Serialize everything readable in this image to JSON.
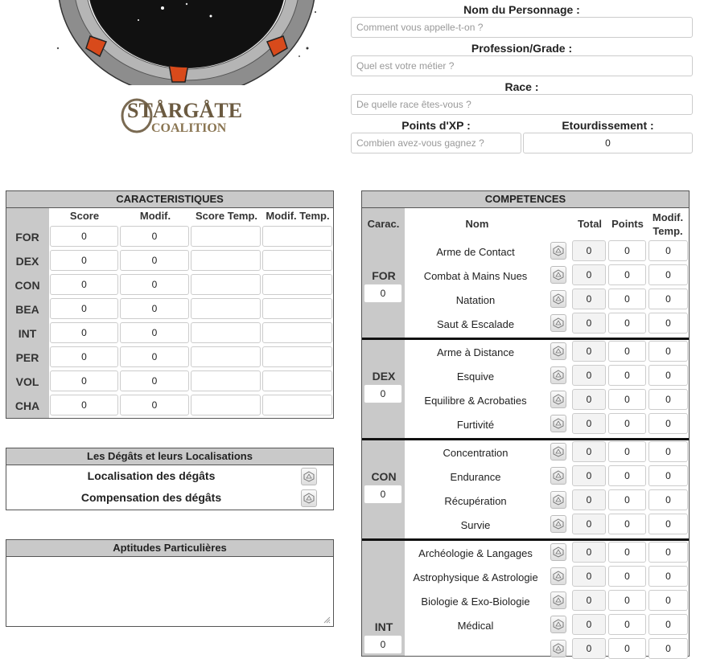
{
  "logo": {
    "line1": "STARGATE",
    "line2": "COALITION"
  },
  "identity": {
    "name_label": "Nom du Personnage :",
    "name_placeholder": "Comment vous appelle-t-on ?",
    "profession_label": "Profession/Grade :",
    "profession_placeholder": "Quel est votre métier ?",
    "race_label": "Race :",
    "race_placeholder": "De quelle race êtes-vous ?",
    "xp_label": "Points d'XP :",
    "xp_placeholder": "Combien avez-vous gagnez ?",
    "stun_label": "Etourdissement :",
    "stun_value": "0"
  },
  "characteristics": {
    "title": "CARACTERISTIQUES",
    "headers": [
      "Score",
      "Modif.",
      "Score Temp.",
      "Modif. Temp."
    ],
    "rows": [
      {
        "abbr": "FOR",
        "score": "0",
        "modif": "0"
      },
      {
        "abbr": "DEX",
        "score": "0",
        "modif": "0"
      },
      {
        "abbr": "CON",
        "score": "0",
        "modif": "0"
      },
      {
        "abbr": "BEA",
        "score": "0",
        "modif": "0"
      },
      {
        "abbr": "INT",
        "score": "0",
        "modif": "0"
      },
      {
        "abbr": "PER",
        "score": "0",
        "modif": "0"
      },
      {
        "abbr": "VOL",
        "score": "0",
        "modif": "0"
      },
      {
        "abbr": "CHA",
        "score": "0",
        "modif": "0"
      }
    ]
  },
  "damage": {
    "title": "Les Dégâts et leurs Localisations",
    "location_label": "Localisation des dégâts",
    "compensation_label": "Compensation des dégâts"
  },
  "aptitudes": {
    "title": "Aptitudes Particulières"
  },
  "competences": {
    "title": "COMPETENCES",
    "headers": {
      "carac": "Carac.",
      "nom": "Nom",
      "total": "Total",
      "points": "Points",
      "modif_line1": "Modif.",
      "modif_line2": "Temp."
    },
    "groups": [
      {
        "carac": "FOR",
        "value": "0",
        "skills": [
          {
            "name": "Arme de Contact",
            "total": "0",
            "points": "0",
            "modif": "0"
          },
          {
            "name": "Combat à Mains Nues",
            "total": "0",
            "points": "0",
            "modif": "0"
          },
          {
            "name": "Natation",
            "total": "0",
            "points": "0",
            "modif": "0"
          },
          {
            "name": "Saut & Escalade",
            "total": "0",
            "points": "0",
            "modif": "0"
          }
        ]
      },
      {
        "carac": "DEX",
        "value": "0",
        "skills": [
          {
            "name": "Arme à Distance",
            "total": "0",
            "points": "0",
            "modif": "0"
          },
          {
            "name": "Esquive",
            "total": "0",
            "points": "0",
            "modif": "0"
          },
          {
            "name": "Equilibre & Acrobaties",
            "total": "0",
            "points": "0",
            "modif": "0"
          },
          {
            "name": "Furtivité",
            "total": "0",
            "points": "0",
            "modif": "0"
          }
        ]
      },
      {
        "carac": "CON",
        "value": "0",
        "skills": [
          {
            "name": "Concentration",
            "total": "0",
            "points": "0",
            "modif": "0"
          },
          {
            "name": "Endurance",
            "total": "0",
            "points": "0",
            "modif": "0"
          },
          {
            "name": "Récupération",
            "total": "0",
            "points": "0",
            "modif": "0"
          },
          {
            "name": "Survie",
            "total": "0",
            "points": "0",
            "modif": "0"
          }
        ]
      },
      {
        "carac": "INT",
        "value": "0",
        "skills": [
          {
            "name": "Archéologie & Langages",
            "total": "0",
            "points": "0",
            "modif": "0"
          },
          {
            "name": "Astrophysique & Astrologie",
            "total": "0",
            "points": "0",
            "modif": "0"
          },
          {
            "name": "Biologie & Exo-Biologie",
            "total": "0",
            "points": "0",
            "modif": "0"
          },
          {
            "name": "Médical",
            "total": "0",
            "points": "0",
            "modif": "0"
          },
          {
            "name": "",
            "total": "0",
            "points": "0",
            "modif": "0"
          }
        ]
      }
    ]
  },
  "icons": {
    "dice": "dice-roll-icon",
    "resize": "resize-handle-icon"
  }
}
